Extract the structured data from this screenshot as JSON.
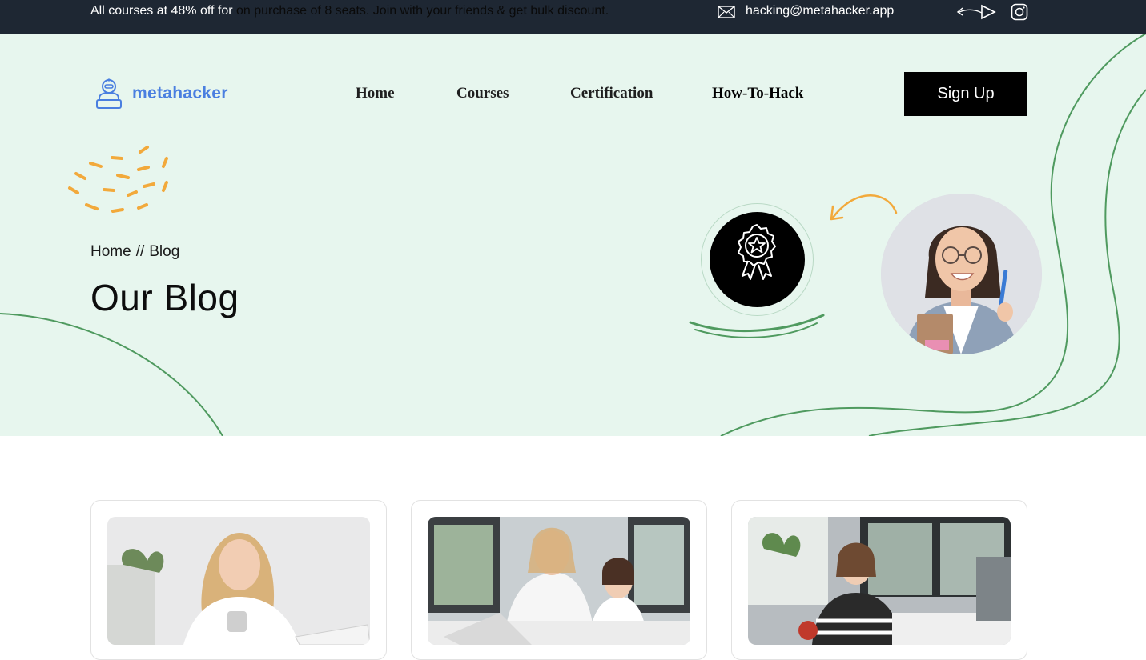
{
  "topbar": {
    "promo_prefix": "All courses at 48% off for ",
    "promo_suffix": "on purchase of 8 seats. Join with your friends & get bulk discount.",
    "email": "hacking@metahacker.app",
    "icons": [
      "mail-icon",
      "arrow-icon",
      "instagram-icon"
    ]
  },
  "header": {
    "logo_text": "metahacker",
    "nav": [
      "Home",
      "Courses",
      "Certification",
      "How-To-Hack"
    ],
    "signup_label": "Sign Up"
  },
  "hero": {
    "breadcrumb": [
      "Home",
      "//",
      "Blog"
    ],
    "title": "Our Blog",
    "icons": [
      "award-badge-icon",
      "curved-arrow-icon"
    ]
  },
  "colors": {
    "topbar_bg": "#1e2733",
    "hero_bg": "#e7f6ee",
    "accent_green": "#4f9a5f",
    "accent_orange": "#f2a93b",
    "logo_blue": "#4a7fe0",
    "button_bg": "#000000"
  },
  "blog_cards": [
    {
      "image": "woman-with-laptop"
    },
    {
      "image": "mother-and-daughter-studying"
    },
    {
      "image": "girl-studying-at-desk"
    }
  ]
}
